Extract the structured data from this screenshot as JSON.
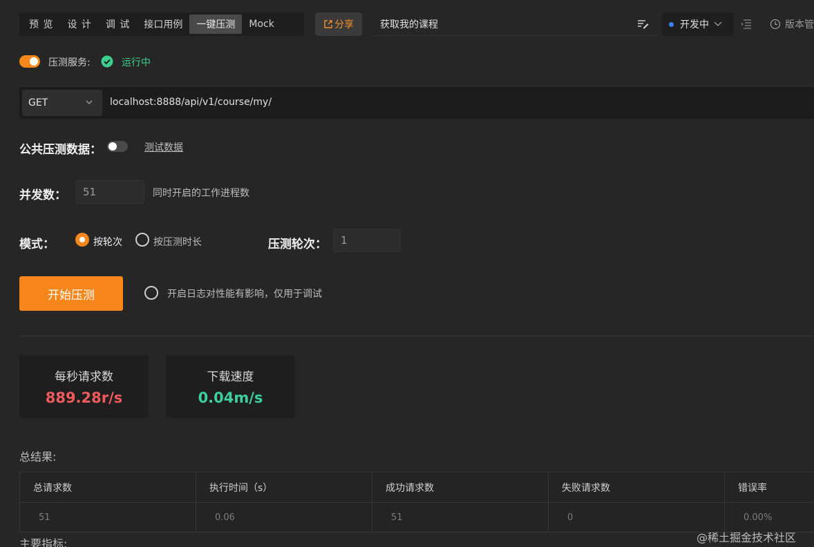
{
  "header": {
    "tabs": [
      {
        "label": "预 览"
      },
      {
        "label": "设 计"
      },
      {
        "label": "调 试"
      },
      {
        "label": "接口用例"
      },
      {
        "label": "一键压测"
      },
      {
        "label": "Mock"
      }
    ],
    "active_tab": "一键压测",
    "share_label": "分享",
    "api_title": "获取我的课程",
    "env_label": "开发中",
    "version_label": "版本管"
  },
  "service": {
    "label": "压测服务:",
    "status": "运行中",
    "enabled": true
  },
  "request": {
    "method": "GET",
    "url": "localhost:8888/api/v1/course/my/"
  },
  "public_data": {
    "label": "公共压测数据：",
    "enabled": false,
    "link": "测试数据"
  },
  "concurrency": {
    "label": "并发数：",
    "value": "51",
    "hint": "同时开启的工作进程数"
  },
  "mode": {
    "label": "模式：",
    "options": [
      "按轮次",
      "按压测时长"
    ],
    "selected": "按轮次",
    "rounds_label": "压测轮次：",
    "rounds_value": "1"
  },
  "actions": {
    "start_label": "开始压测",
    "log_label": "开启日志对性能有影响，仅用于调试",
    "log_enabled": false
  },
  "stats": [
    {
      "title": "每秒请求数",
      "value": "889.28r/s",
      "color": "#ef5b5b"
    },
    {
      "title": "下载速度",
      "value": "0.04m/s",
      "color": "#3ecf9e"
    }
  ],
  "results": {
    "label": "总结果:",
    "columns": [
      "总请求数",
      "执行时间（s）",
      "成功请求数",
      "失败请求数",
      "错误率"
    ],
    "rows": [
      [
        "51",
        "0.06",
        "51",
        "0",
        "0.00%"
      ]
    ]
  },
  "metrics_label": "主要指标:",
  "watermark": "@稀土掘金技术社区",
  "colors": {
    "accent": "#f7871a",
    "success": "#3ecf8e",
    "background": "#262626"
  }
}
